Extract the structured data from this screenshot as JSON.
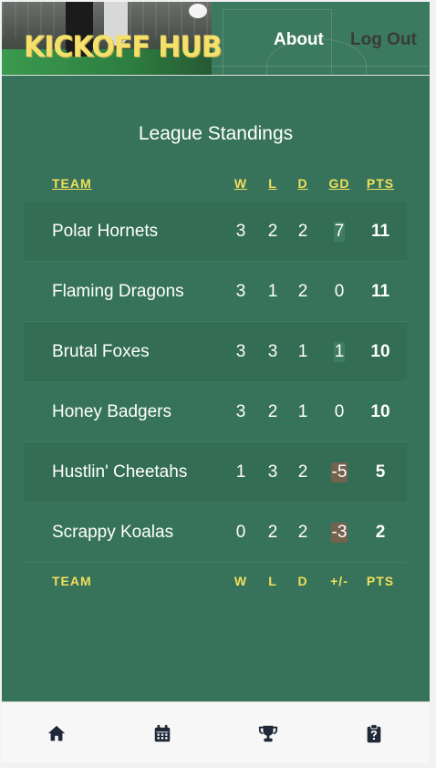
{
  "header": {
    "logo_text": "KICKOFF HUB",
    "nav": {
      "about": "About",
      "logout": "Log Out"
    }
  },
  "main": {
    "title": "League Standings",
    "columns_top": {
      "team": "TEAM",
      "w": "W",
      "l": "L",
      "d": "D",
      "gd": "GD",
      "pts": "PTS"
    },
    "columns_bottom": {
      "team": "TEAM",
      "w": "W",
      "l": "L",
      "d": "D",
      "gd": "+/-",
      "pts": "PTS"
    },
    "rows": [
      {
        "team": "Polar Hornets",
        "w": "3",
        "l": "2",
        "d": "2",
        "gd": "7",
        "pts": "11"
      },
      {
        "team": "Flaming Dragons",
        "w": "3",
        "l": "1",
        "d": "2",
        "gd": "0",
        "pts": "11"
      },
      {
        "team": "Brutal Foxes",
        "w": "3",
        "l": "3",
        "d": "1",
        "gd": "1",
        "pts": "10"
      },
      {
        "team": "Honey Badgers",
        "w": "3",
        "l": "2",
        "d": "1",
        "gd": "0",
        "pts": "10"
      },
      {
        "team": "Hustlin' Cheetahs",
        "w": "1",
        "l": "3",
        "d": "2",
        "gd": "-5",
        "pts": "5"
      },
      {
        "team": "Scrappy Koalas",
        "w": "0",
        "l": "2",
        "d": "2",
        "gd": "-3",
        "pts": "2"
      }
    ]
  },
  "bottom_nav": {
    "items": [
      {
        "icon": "home-icon"
      },
      {
        "icon": "calendar-icon"
      },
      {
        "icon": "trophy-icon"
      },
      {
        "icon": "clipboard-question-icon"
      }
    ]
  },
  "colors": {
    "header_green": "#3b7a5e",
    "main_green": "#37735a",
    "stripe_green": "#336d54",
    "accent_yellow": "#f3df5c",
    "nav_icon": "#1f2937"
  }
}
